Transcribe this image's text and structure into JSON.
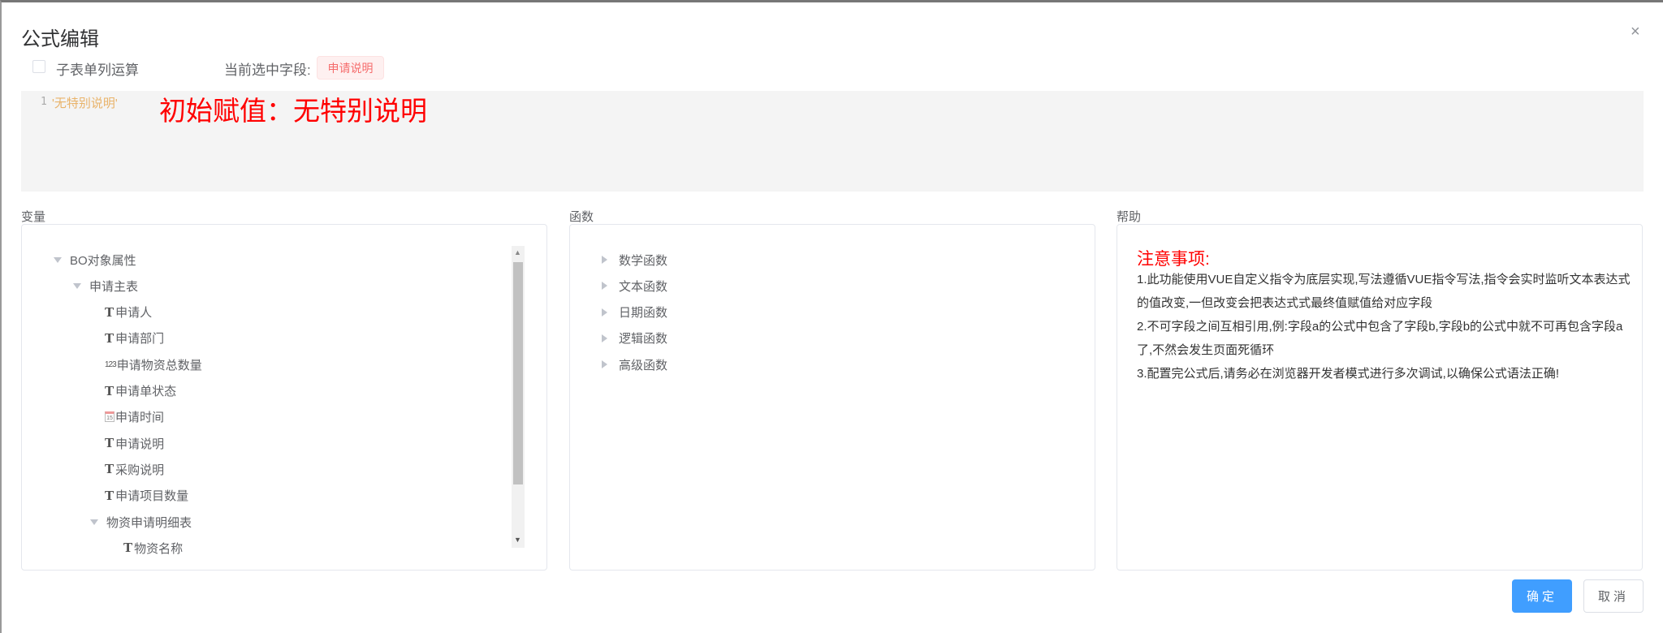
{
  "dialog": {
    "title": "公式编辑",
    "close_icon": "×"
  },
  "options": {
    "subtable_checkbox_label": "子表单列运算",
    "subtable_checked": false,
    "current_field_label": "当前选中字段:",
    "current_field_value": "申请说明"
  },
  "editor": {
    "line_number": "1",
    "code": "'无特别说明'",
    "annotation": "初始赋值：无特别说明"
  },
  "variables": {
    "label": "变量",
    "tree": [
      {
        "label": "BO对象属性",
        "type": "group"
      },
      {
        "label": "申请主表",
        "type": "group"
      },
      {
        "label": "申请人",
        "type": "text"
      },
      {
        "label": "申请部门",
        "type": "text"
      },
      {
        "label": "申请物资总数量",
        "type": "number"
      },
      {
        "label": "申请单状态",
        "type": "text"
      },
      {
        "label": "申请时间",
        "type": "date"
      },
      {
        "label": "申请说明",
        "type": "text"
      },
      {
        "label": "采购说明",
        "type": "text"
      },
      {
        "label": "申请项目数量",
        "type": "text"
      },
      {
        "label": "物资申请明细表",
        "type": "group"
      },
      {
        "label": "物资名称",
        "type": "text"
      }
    ],
    "icons": {
      "text": "T",
      "number": "123",
      "date": "15"
    }
  },
  "functions": {
    "label": "函数",
    "items": [
      "数学函数",
      "文本函数",
      "日期函数",
      "逻辑函数",
      "高级函数"
    ]
  },
  "help": {
    "label": "帮助",
    "title": "注意事项:",
    "lines": [
      "1.此功能使用VUE自定义指令为底层实现,写法遵循VUE指令写法,指令会实时监听文本表达式的值改变,一但改变会把表达式式最终值赋值给对应字段",
      "2.不可字段之间互相引用,例:字段a的公式中包含了字段b,字段b的公式中就不可再包含字段a了,不然会发生页面死循环",
      "3.配置完公式后,请务必在浏览器开发者模式进行多次调试,以确保公式语法正确!"
    ]
  },
  "footer": {
    "confirm": "确定",
    "cancel": "取消"
  },
  "colors": {
    "primary": "#409eff",
    "danger": "#ff0000",
    "tag": "#f56c6c"
  }
}
